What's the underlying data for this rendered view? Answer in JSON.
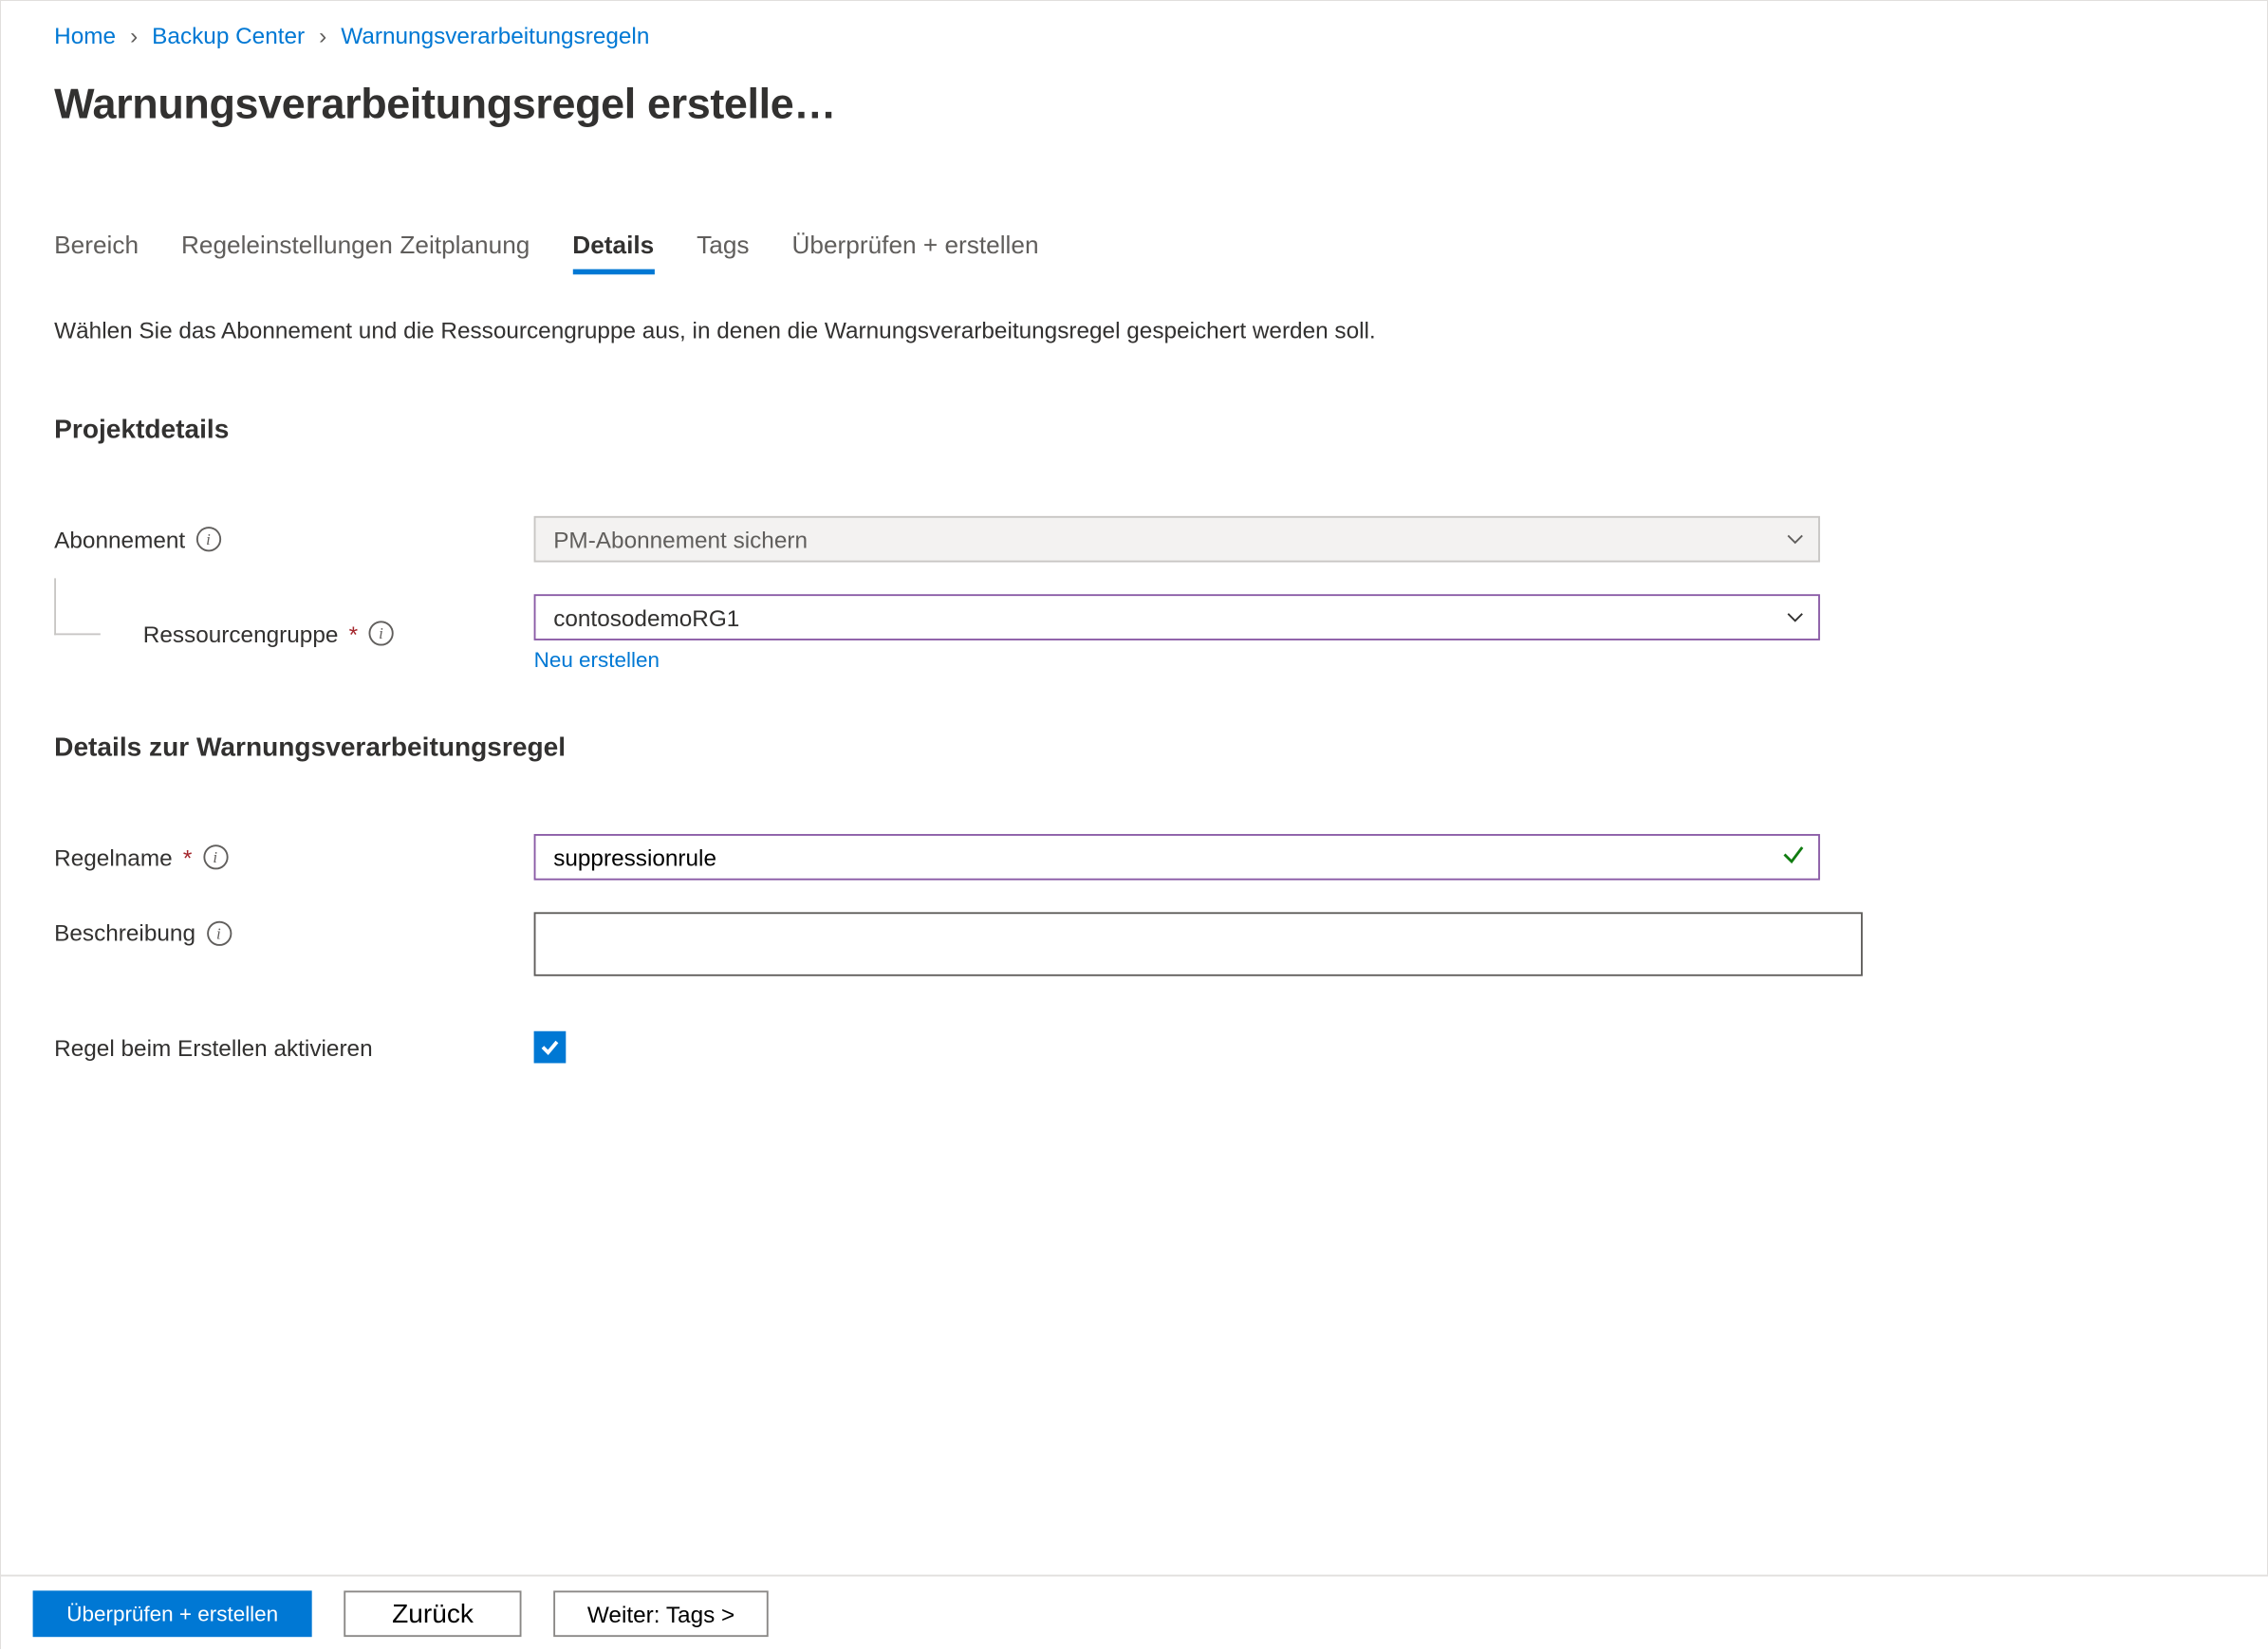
{
  "breadcrumb": {
    "home": "Home",
    "backup_center": "Backup Center",
    "rules": "Warnungsverarbeitungsregeln"
  },
  "page_title": "Warnungsverarbeitungsregel erstelle…",
  "tabs": {
    "bereich": "Bereich",
    "regeleinstellungen": "Regeleinstellungen",
    "zeitplanung": "Zeitplanung",
    "details": "Details",
    "tags": "Tags",
    "review": "Überprüfen + erstellen"
  },
  "intro_text": "Wählen Sie das Abonnement und die Ressourcengruppe aus, in denen die Warnungsverarbeitungsregel gespeichert werden soll.",
  "sections": {
    "project": "Projektdetails",
    "rule_details": "Details zur Warnungsverarbeitungsregel"
  },
  "fields": {
    "subscription": {
      "label": "Abonnement",
      "value": "PM-Abonnement sichern"
    },
    "resource_group": {
      "label": "Ressourcengruppe",
      "value": "contosodemoRG1",
      "new_link": "Neu erstellen"
    },
    "rule_name": {
      "label": "Regelname",
      "value": "suppressionrule"
    },
    "description": {
      "label": "Beschreibung",
      "value": ""
    },
    "enable": {
      "label": "Regel beim Erstellen aktivieren"
    }
  },
  "footer": {
    "review": "Überprüfen +   erstellen",
    "back": "Zurück",
    "next": "Weiter: Tags >"
  }
}
